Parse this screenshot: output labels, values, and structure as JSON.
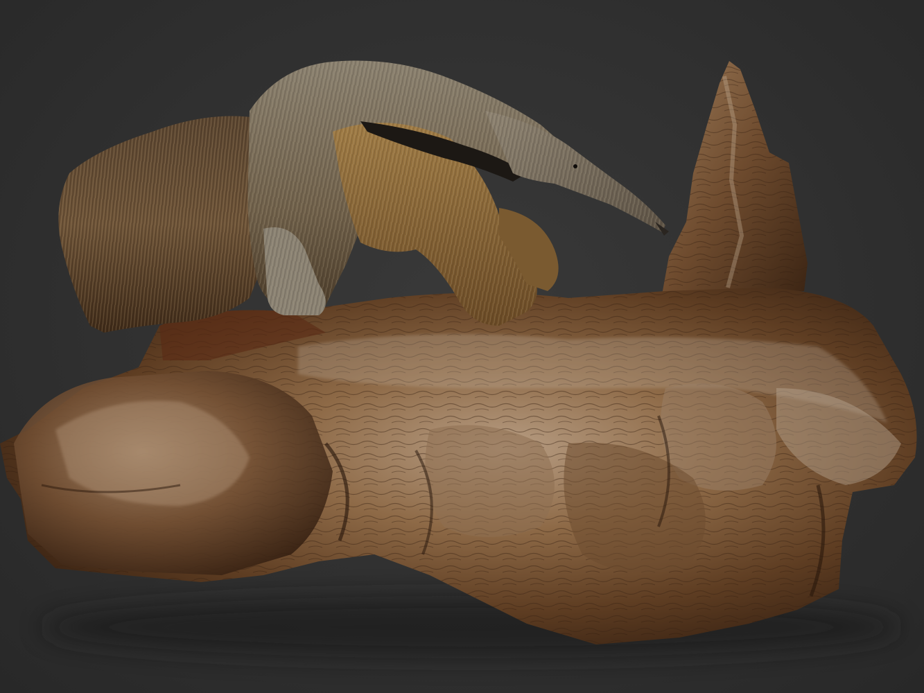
{
  "scene": {
    "subject": "anteater-on-log",
    "background_color": "#2e2e2e",
    "colors": {
      "log_dark": "#3a2414",
      "log_mid": "#7a5634",
      "log_light": "#a88a6c",
      "log_highlight": "#c9b7a2",
      "fur_grey": "#7b7164",
      "fur_brown": "#6b4a28",
      "fur_gold": "#9a7a45",
      "stripe_black": "#1c1814"
    }
  }
}
